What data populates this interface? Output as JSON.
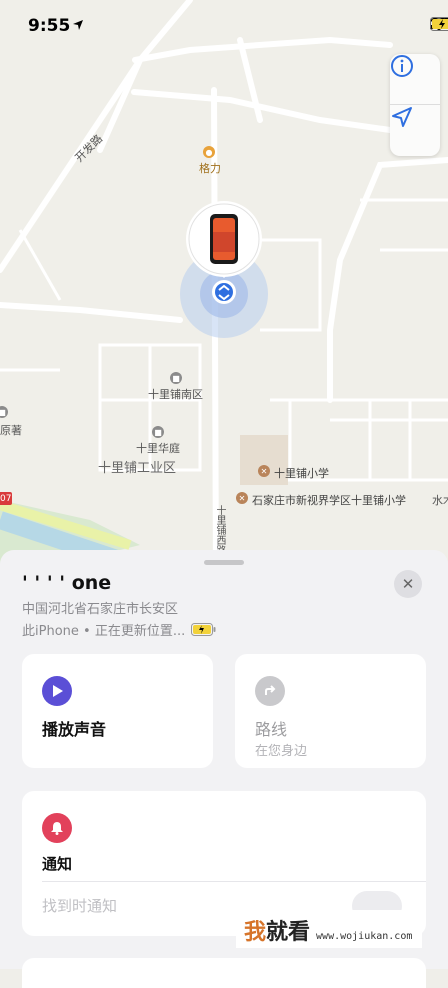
{
  "status_bar": {
    "time": "9:55",
    "location_arrow": "location-arrow-icon",
    "signal": "signal-bars-icon",
    "wifi": "wifi-icon",
    "battery": "battery-charging-icon"
  },
  "map_controls": {
    "info": "info-icon",
    "location": "location-arrow-icon"
  },
  "map_labels": {
    "kaifa_road": "开发路",
    "geli": "格力",
    "shilipu_south": "十里铺南区",
    "shilipu_huating": "十里华庭",
    "shilipu_industrial": "十里铺工业区",
    "shilipu_school": "十里铺小学",
    "school_district": "石家庄市新视界学区十里铺小学",
    "yuanzhu": "原著",
    "shui": "水木",
    "road_vertical": "十里铺西路",
    "road_sign": "07"
  },
  "sheet": {
    "device_name": "' ' ' ' one",
    "address": "中国河北省石家庄市长安区",
    "status_text": "此iPhone • 正在更新位置...",
    "close": "✕"
  },
  "actions": {
    "play_sound": "播放声音",
    "directions": "路线",
    "directions_sub": "在您身边"
  },
  "notify": {
    "title": "通知",
    "notify_when_found": "找到时通知"
  },
  "colors": {
    "purple": "#5b4fd6",
    "red": "#e2415b",
    "gray_icon": "#c9c9cc",
    "accent_blue": "#2f6fe0"
  },
  "watermark": {
    "brand_part1": "我",
    "brand_part2": "就看",
    "url": "www.wojiukan.com"
  }
}
